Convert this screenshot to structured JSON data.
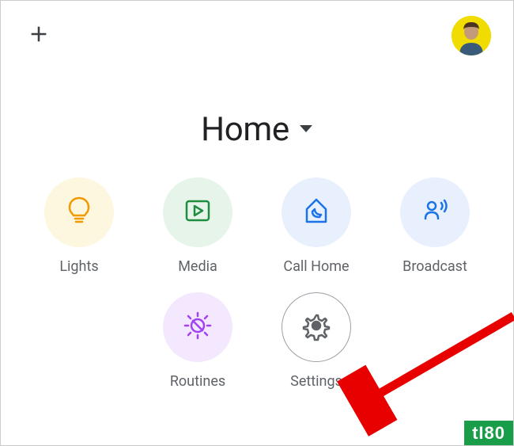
{
  "header": {
    "title": "Home"
  },
  "tiles": {
    "lights": {
      "label": "Lights",
      "icon": "bulb",
      "circleClass": "c-lights",
      "iconColor": "#f29900"
    },
    "media": {
      "label": "Media",
      "icon": "play",
      "circleClass": "c-media",
      "iconColor": "#1e8e3e"
    },
    "callhome": {
      "label": "Call Home",
      "icon": "house-phone",
      "circleClass": "c-callhome",
      "iconColor": "#1a73e8"
    },
    "broadcast": {
      "label": "Broadcast",
      "icon": "broadcast",
      "circleClass": "c-broadcast",
      "iconColor": "#1a73e8"
    },
    "routines": {
      "label": "Routines",
      "icon": "routine",
      "circleClass": "c-routines",
      "iconColor": "#a142f4"
    },
    "settings": {
      "label": "Settings",
      "icon": "gear",
      "circleClass": "c-settings",
      "iconColor": "#5f6368"
    }
  },
  "watermark": "tI80"
}
